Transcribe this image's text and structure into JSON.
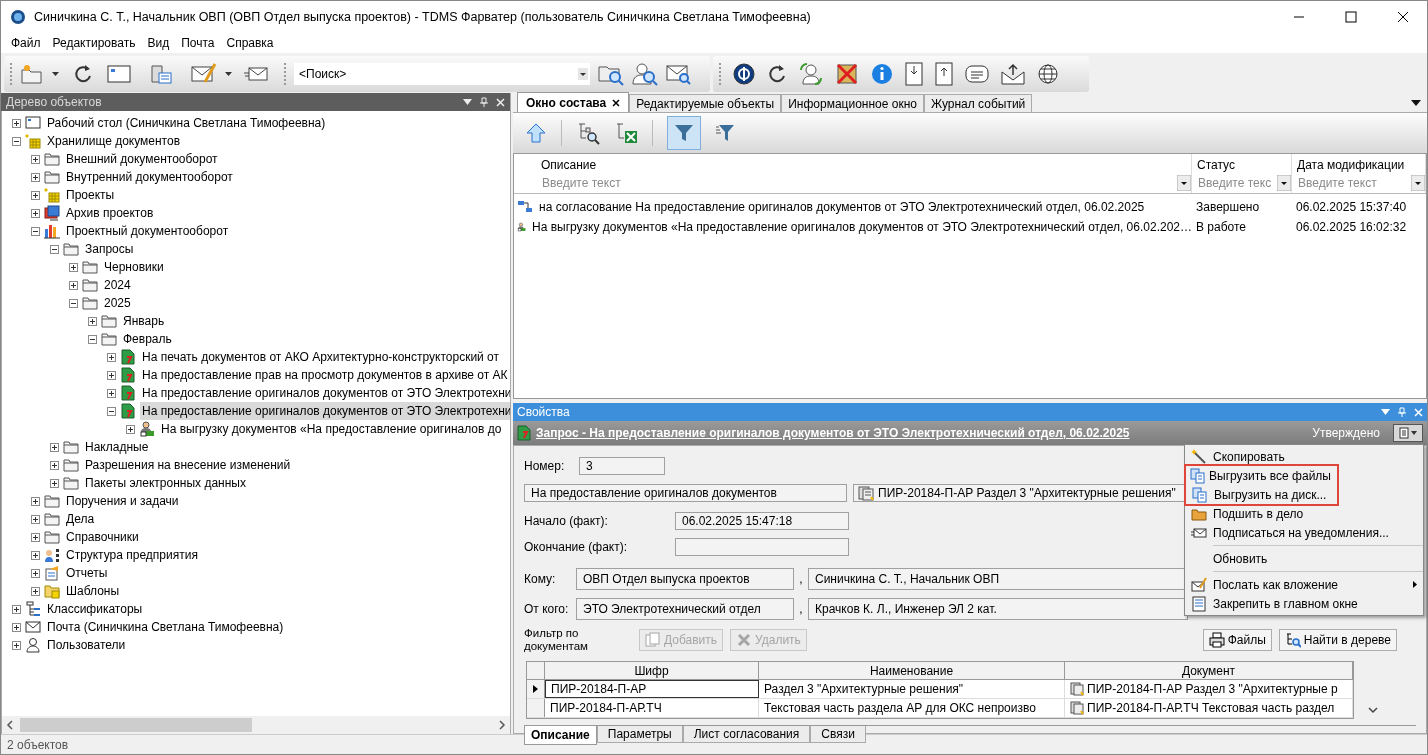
{
  "window": {
    "title": "Синичкина С. Т., Начальник ОВП (ОВП Отдел выпуска проектов) - TDMS Фарватер (пользователь Синичкина Светлана Тимофеевна)"
  },
  "menu": [
    "Файл",
    "Редактировать",
    "Вид",
    "Почта",
    "Справка"
  ],
  "search": {
    "value": "<Поиск>"
  },
  "tree": {
    "title": "Дерево объектов",
    "nodes": [
      {
        "label": "Рабочий стол (Синичкина Светлана Тимофеевна)",
        "kind": "desktop",
        "expanded": false,
        "selected": false
      },
      {
        "label": "Хранилище документов",
        "kind": "storage",
        "expanded": true,
        "selected": false,
        "children": [
          {
            "label": "Внешний документооборот",
            "kind": "folder",
            "expanded": false,
            "selected": false
          },
          {
            "label": "Внутренний документооборот",
            "kind": "folder",
            "expanded": false,
            "selected": false
          },
          {
            "label": "Проекты",
            "kind": "storage",
            "expanded": false,
            "selected": false
          },
          {
            "label": "Архив проектов",
            "kind": "archive",
            "expanded": false,
            "selected": false
          },
          {
            "label": "Проектный документооборот",
            "kind": "chart",
            "expanded": true,
            "selected": false,
            "children": [
              {
                "label": "Запросы",
                "kind": "folder",
                "expanded": true,
                "selected": false,
                "children": [
                  {
                    "label": "Черновики",
                    "kind": "folder",
                    "expanded": false,
                    "selected": false
                  },
                  {
                    "label": "2024",
                    "kind": "folder",
                    "expanded": false,
                    "selected": false
                  },
                  {
                    "label": "2025",
                    "kind": "folder",
                    "expanded": true,
                    "selected": false,
                    "children": [
                      {
                        "label": "Январь",
                        "kind": "folder",
                        "expanded": false,
                        "selected": false
                      },
                      {
                        "label": "Февраль",
                        "kind": "folder",
                        "expanded": true,
                        "selected": false,
                        "children": [
                          {
                            "label": "На печать документов от АКО Архитектурно-конструкторский от",
                            "kind": "request",
                            "expanded": false,
                            "selected": false
                          },
                          {
                            "label": "На предоставление прав на просмотр документов в архиве от АК",
                            "kind": "request",
                            "expanded": false,
                            "selected": false
                          },
                          {
                            "label": "На предоставление оригиналов документов от ЭТО Электротехни",
                            "kind": "request",
                            "expanded": false,
                            "selected": false
                          },
                          {
                            "label": "На предоставление оригиналов документов от ЭТО Электротехни",
                            "kind": "request",
                            "expanded": true,
                            "selected": true,
                            "children": [
                              {
                                "label": "На выгрузку документов «На предоставление оригиналов до",
                                "kind": "unload",
                                "expanded": false,
                                "selected": false
                              }
                            ]
                          }
                        ]
                      }
                    ]
                  }
                ]
              },
              {
                "label": "Накладные",
                "kind": "folder",
                "expanded": false,
                "selected": false
              },
              {
                "label": "Разрешения на внесение изменений",
                "kind": "folder",
                "expanded": false,
                "selected": false
              },
              {
                "label": "Пакеты электронных данных",
                "kind": "folder",
                "expanded": false,
                "selected": false
              }
            ]
          },
          {
            "label": "Поручения и задачи",
            "kind": "folder",
            "expanded": false,
            "selected": false
          },
          {
            "label": "Дела",
            "kind": "folder",
            "expanded": false,
            "selected": false
          },
          {
            "label": "Справочники",
            "kind": "folder",
            "expanded": false,
            "selected": false
          },
          {
            "label": "Структура предприятия",
            "kind": "org",
            "expanded": false,
            "selected": false
          },
          {
            "label": "Отчеты",
            "kind": "reports",
            "expanded": false,
            "selected": false
          },
          {
            "label": "Шаблоны",
            "kind": "templates",
            "expanded": false,
            "selected": false
          }
        ]
      },
      {
        "label": "Классификаторы",
        "kind": "classifier",
        "expanded": false,
        "selected": false
      },
      {
        "label": "Почта (Синичкина Светлана Тимофеевна)",
        "kind": "mail",
        "expanded": false,
        "selected": false
      },
      {
        "label": "Пользователи",
        "kind": "users",
        "expanded": false,
        "selected": false
      }
    ]
  },
  "tabs": [
    {
      "label": "Окно состава",
      "selected": true,
      "closable": true
    },
    {
      "label": "Редактируемые объекты",
      "selected": false,
      "closable": false
    },
    {
      "label": "Информационное окно",
      "selected": false,
      "closable": false
    },
    {
      "label": "Журнал событий",
      "selected": false,
      "closable": false
    }
  ],
  "grid": {
    "columns": [
      {
        "title": "Описание",
        "placeholder": "Введите текст"
      },
      {
        "title": "Статус",
        "placeholder": "Введите текс"
      },
      {
        "title": "Дата модификации",
        "placeholder": "Введите текст"
      }
    ],
    "rows": [
      {
        "kind": "route",
        "cells": [
          "на согласование На предоставление оригиналов документов от ЭТО Электротехнический отдел, 06.02.2025",
          "Завершено",
          "06.02.2025 15:37:40"
        ]
      },
      {
        "kind": "unload",
        "cells": [
          "На выгрузку документов «На предоставление оригиналов документов от ЭТО Электротехнический отдел, 06.02.202…",
          "В работе",
          "06.02.2025 16:02:32"
        ]
      }
    ]
  },
  "properties": {
    "title": "Свойства",
    "object_title": "Запрос - На предоставление оригиналов документов от ЭТО Электротехнический отдел, 06.02.2025",
    "state": "Утверждено",
    "number_label": "Номер:",
    "number": "3",
    "name": "На предоставление оригиналов документов",
    "document": "ПИР-20184-П-АР Раздел 3 \"Архитектурные решения\"",
    "start_label": "Начало (факт):",
    "start": "06.02.2025 15:47:18",
    "end_label": "Окончание (факт):",
    "to_label": "Кому:",
    "to_dept": "ОВП Отдел выпуска проектов",
    "to_sep": ",",
    "to_person": "Синичкина С. Т., Начальник ОВП",
    "from_label": "От кого:",
    "from_dept": "ЭТО Электротехнический отдел",
    "from_sep": ",",
    "from_person": "Крачков К. Л., Инженер ЭЛ 2 кат.",
    "filter_label": "Фильтр по документам",
    "buttons": [
      {
        "kind": "add",
        "label": "Добавить",
        "disabled": true
      },
      {
        "kind": "delete",
        "label": "Удалить",
        "disabled": true
      },
      {
        "kind": "files",
        "label": "Файлы",
        "disabled": false
      },
      {
        "kind": "find",
        "label": "Найти в дереве",
        "disabled": false
      }
    ],
    "table": {
      "columns": [
        "Шифр",
        "Наименование",
        "Документ"
      ],
      "rows": [
        {
          "selected": true,
          "cells": [
            "ПИР-20184-П-АР",
            "Раздел 3 \"Архитектурные решения\"",
            "ПИР-20184-П-АР Раздел 3 \"Архитектурные р"
          ]
        },
        {
          "selected": false,
          "cells": [
            "ПИР-20184-П-АР.ТЧ",
            "Текстовая часть раздела АР для ОКС непроизво",
            "ПИР-20184-П-АР.ТЧ Текстовая часть раздел"
          ]
        }
      ]
    },
    "tabs": [
      {
        "label": "Описание",
        "selected": true
      },
      {
        "label": "Параметры",
        "selected": false
      },
      {
        "label": "Лист согласования",
        "selected": false
      },
      {
        "label": "Связи",
        "selected": false
      }
    ]
  },
  "context_menu": [
    {
      "kind": "copy",
      "label": "Скопировать",
      "highlighted": false
    },
    {
      "kind": "unload_all",
      "label": "Выгрузить все файлы",
      "highlighted": true
    },
    {
      "kind": "unload_disk",
      "label": "Выгрузить на диск...",
      "highlighted": true
    },
    {
      "kind": "file_case",
      "label": "Подшить в дело",
      "highlighted": false
    },
    {
      "kind": "subscribe",
      "label": "Подписаться на уведомления...",
      "highlighted": false
    },
    {
      "kind": "separator"
    },
    {
      "kind": "refresh",
      "label": "Обновить",
      "highlighted": false
    },
    {
      "kind": "separator"
    },
    {
      "kind": "send",
      "label": "Послать как вложение",
      "highlighted": false,
      "submenu": true
    },
    {
      "kind": "pin",
      "label": "Закрепить в главном окне",
      "highlighted": false
    }
  ],
  "status_bar": "2 объектов"
}
